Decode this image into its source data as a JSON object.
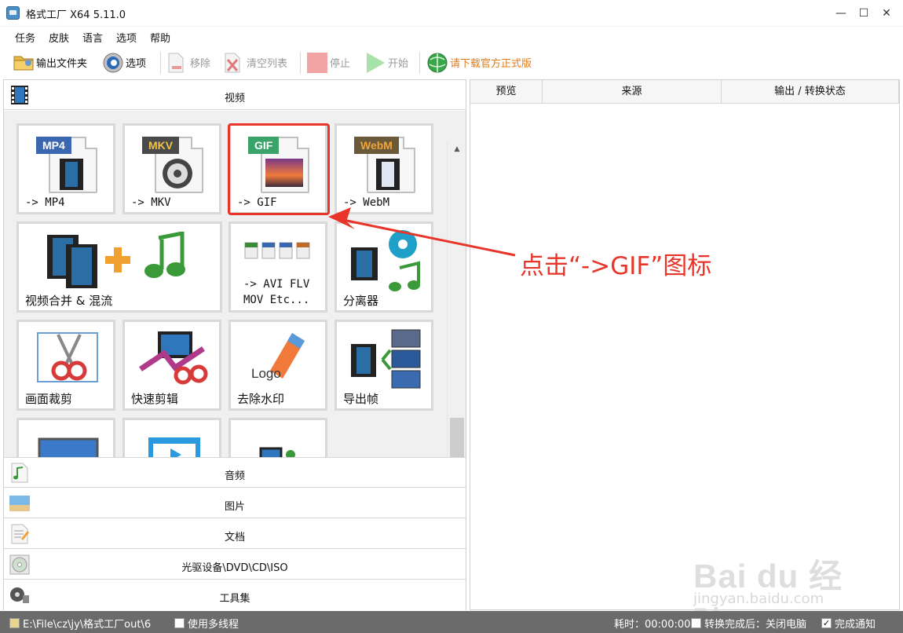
{
  "window": {
    "title": "格式工厂 X64 5.11.0",
    "minimize": "—",
    "maximize": "☐",
    "close": "✕"
  },
  "menu": [
    "任务",
    "皮肤",
    "语言",
    "选项",
    "帮助"
  ],
  "toolbar": {
    "output_folder": "输出文件夹",
    "options": "选项",
    "remove": "移除",
    "clear_list": "清空列表",
    "stop": "停止",
    "start": "开始",
    "download": "请下载官方正式版"
  },
  "categories": {
    "video": "视频",
    "audio": "音频",
    "image": "图片",
    "document": "文档",
    "disc": "光驱设备\\DVD\\CD\\ISO",
    "tools": "工具集"
  },
  "tiles": {
    "mp4": {
      "tag": "MP4",
      "label": "-> MP4"
    },
    "mkv": {
      "tag": "MKV",
      "label": "-> MKV"
    },
    "gif": {
      "tag": "GIF",
      "label": "-> GIF"
    },
    "webm": {
      "tag": "WebM",
      "label": "-> WebM"
    },
    "merge": {
      "label": "视频合并 & 混流"
    },
    "avi": {
      "label_line1": "-> AVI FLV",
      "label_line2": "MOV Etc..."
    },
    "splitter": {
      "label": "分离器"
    },
    "crop": {
      "label": "画面裁剪"
    },
    "quick_cut": {
      "label": "快速剪辑"
    },
    "remove_watermark": {
      "label": "去除水印",
      "logo_text": "Logo"
    },
    "export_frames": {
      "label": "导出帧"
    }
  },
  "task_table": {
    "columns": [
      "预览",
      "来源",
      "输出 / 转换状态"
    ]
  },
  "annotation": {
    "text": "点击“->GIF”图标",
    "color": "#e8352a"
  },
  "statusbar": {
    "path": "E:\\File\\cz\\jy\\格式工厂out\\6",
    "multithread": "使用多线程",
    "elapsed": "耗时：00:00:00",
    "after_convert": "转换完成后：关闭电脑",
    "notify": "完成通知",
    "notify_checked": "✓"
  },
  "watermark": {
    "logo": "Bai du 经验",
    "url": "jingyan.baidu.com"
  }
}
